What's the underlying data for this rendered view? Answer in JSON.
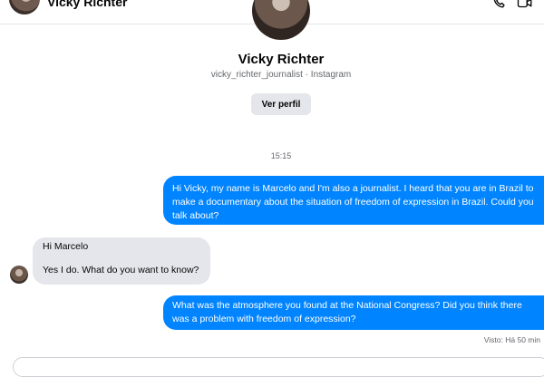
{
  "header": {
    "contact_name": "Vicky Richter",
    "icons": [
      "phone-icon",
      "video-camera-icon"
    ]
  },
  "profile": {
    "name": "Vicky Richter",
    "subtitle": "vicky_richter_journalist · Instagram",
    "button_label": "Ver perfil"
  },
  "conversation": {
    "timestamp": "15:15",
    "messages": [
      {
        "direction": "outgoing",
        "text": "Hi Vicky, my name is Marcelo and I'm also a journalist. I heard that you are in Brazil to make a documentary about the situation of freedom of expression in Brazil. Could you talk about?"
      },
      {
        "direction": "incoming",
        "lines": [
          "Hi Marcelo",
          "Yes I do. What do you want to know?"
        ]
      },
      {
        "direction": "outgoing",
        "text": "What was the atmosphere you found at the National Congress? Did you think there was a problem with freedom of expression?"
      }
    ],
    "seen_status": "Visto: Há 50 min"
  },
  "colors": {
    "outgoing_bubble": "#0084ff",
    "incoming_bubble": "#e4e6eb",
    "secondary_text": "#65676b"
  }
}
